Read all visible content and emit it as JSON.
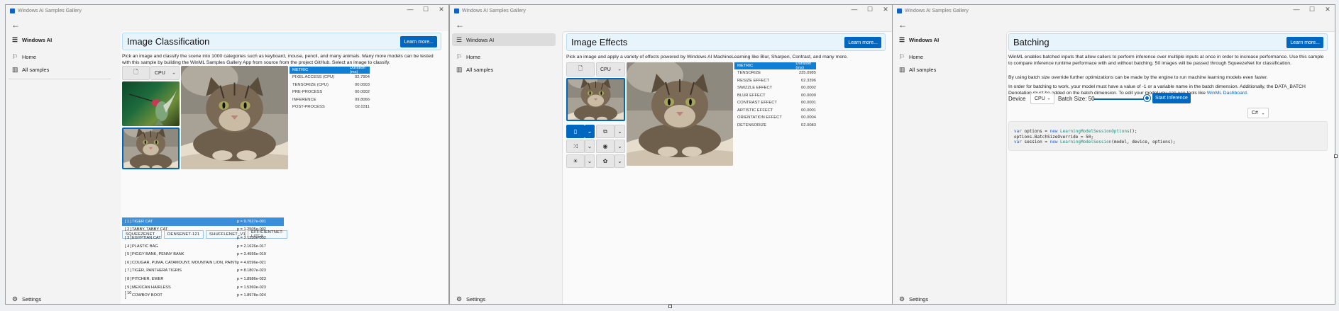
{
  "app_title": "Windows AI Samples Gallery",
  "window_controls": {
    "minimize": "—",
    "maximize": "☐",
    "close": "✕"
  },
  "nav": {
    "header": "Windows AI",
    "home": "Home",
    "all_samples": "All samples",
    "settings": "Settings"
  },
  "panel1": {
    "title": "Image Classification",
    "learn_more": "Learn more...",
    "description": "Pick an image and classify the scene into 1000 categories such as keyboard, mouse, pencil, and many animals. Many more models can be tested with this sample by building the WinML Samples Gallery App from source from the project GitHub. Select an image to classify.",
    "device": "CPU",
    "metrics_header": [
      "Metric",
      "Duration (ms)"
    ],
    "metrics": [
      {
        "name": "Pixel Access (CPU)",
        "value": "02.7904"
      },
      {
        "name": "Tensorize (CPU)",
        "value": "00.0003"
      },
      {
        "name": "Pre-Process",
        "value": "00.0002"
      },
      {
        "name": "Inference",
        "value": "09.8066"
      },
      {
        "name": "Post-Process",
        "value": "02.0311"
      }
    ],
    "models": [
      "SqueezeNet",
      "DenseNet-121",
      "ShuffleNet_v1",
      "EfficientNet-Lite4"
    ],
    "results": [
      {
        "idx": "[ 1 ]",
        "name": "TIGER CAT",
        "p": "p = 9.7627e-001"
      },
      {
        "idx": "[ 2 ]",
        "name": "TABBY, TABBY CAT",
        "p": "p = 1.2505e-002"
      },
      {
        "idx": "[ 3 ]",
        "name": "EGYPTIAN CAT",
        "p": "p = 1.1230e-002"
      },
      {
        "idx": "[ 4 ]",
        "name": "PLASTIC BAG",
        "p": "p = 2.1626e-017"
      },
      {
        "idx": "[ 5 ]",
        "name": "PIGGY BANK, PENNY BANK",
        "p": "p = 3.4556e-019"
      },
      {
        "idx": "[ 6 ]",
        "name": "COUGAR, PUMA, CATAMOUNT, MOUNTAIN LION, PAINTER, PANTHER,...",
        "p": "p = 4.6596e-021"
      },
      {
        "idx": "[ 7 ]",
        "name": "TIGER, PANTHERA TIGRIS",
        "p": "p = 8.1807e-023"
      },
      {
        "idx": "[ 8 ]",
        "name": "PITCHER, EWER",
        "p": "p = 1.8986e-023"
      },
      {
        "idx": "[ 9 ]",
        "name": "MEXICAN HAIRLESS",
        "p": "p = 1.5360e-023"
      },
      {
        "idx": "[ 10 ]",
        "name": "COWBOY BOOT",
        "p": "p = 1.8978e-024"
      }
    ]
  },
  "panel2": {
    "title": "Image Effects",
    "learn_more": "Learn more...",
    "description": "Pick an image and apply a variety of effects powered by Windows AI MachineLearning like Blur, Sharpen, Contrast, and many more.",
    "device": "CPU",
    "metrics_header": [
      "Metric",
      "Duration (ms)"
    ],
    "metrics": [
      {
        "name": "Tensorize",
        "value": "235.0985"
      },
      {
        "name": "Resize Effect",
        "value": "02.3396"
      },
      {
        "name": "Swizzle Effect",
        "value": "00.0002"
      },
      {
        "name": "Blur Effect",
        "value": "00.0000"
      },
      {
        "name": "Contrast Effect",
        "value": "00.0001"
      },
      {
        "name": "Artistic Effect",
        "value": "00.0001"
      },
      {
        "name": "Orientation Effect",
        "value": "00.0004"
      },
      {
        "name": "Detensorize",
        "value": "02.0083"
      }
    ]
  },
  "panel3": {
    "title": "Batching",
    "learn_more": "Learn more...",
    "desc1": "WinML enables batched inputs that allow callers to perform inference over multiple inputs at once in order to increase performance. Use this sample to compare inference runtime performace with and without batching. 50 images will be passed through SqueezeNet for classification.",
    "desc2": "By using batch size override further optimizations can be made by the engine to run machine learning models even faster.",
    "desc3": "In order for batching to work, your model must have a value of -1 or a variable name in the batch dimension. Additionally, the DATA_BATCH Denotation must be added on the batch dimension. To edit your model you can use tools like",
    "desc3_link": "WinML Dashboard",
    "device_label": "Device",
    "device": "CPU",
    "batch_label": "Batch Size: 50",
    "batch_fraction": 1.0,
    "start": "Start Inference",
    "lang": "C#",
    "code": [
      [
        "var ",
        "options",
        " = ",
        "new ",
        "LearningModelSessionOptions",
        "();"
      ],
      [
        "",
        "options.BatchSizeOverride",
        " = 50;",
        "",
        "",
        ""
      ],
      [
        "var ",
        "session",
        " = ",
        "new ",
        "LearningModelSession",
        "(model, device, options);"
      ]
    ]
  }
}
